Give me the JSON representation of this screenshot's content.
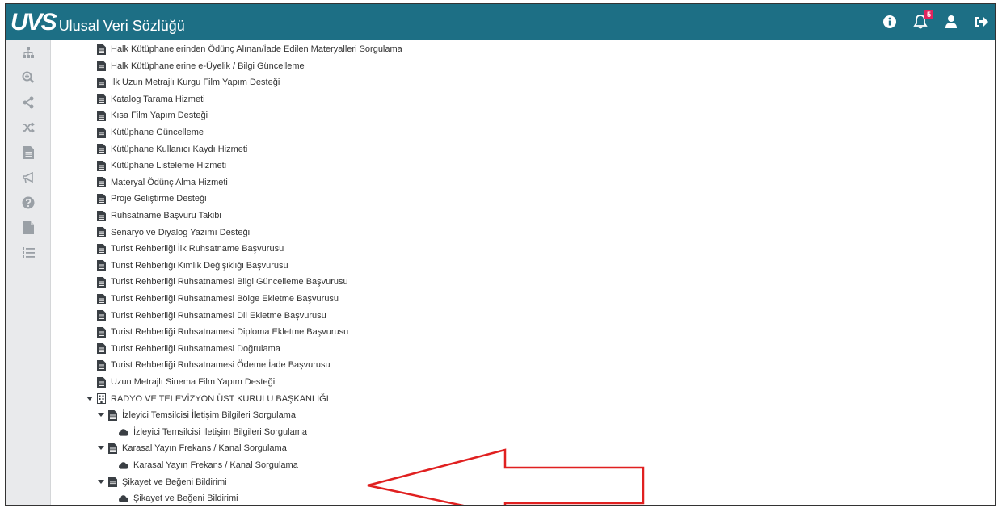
{
  "app": {
    "logo_mark": "UVS",
    "title": "Ulusal Veri Sözlüğü"
  },
  "topbar": {
    "notification_count": "5"
  },
  "sidebar": {
    "items": [
      "sitemap-icon",
      "zoom-in-icon",
      "share-icon",
      "random-icon",
      "document-icon",
      "bullhorn-icon",
      "help-icon",
      "file-icon",
      "list-ol-icon"
    ]
  },
  "list": {
    "items": [
      "Halk Kütüphanelerinden Ödünç Alınan/İade Edilen Materyalleri Sorgulama",
      "Halk Kütüphanelerine e-Üyelik / Bilgi Güncelleme",
      "İlk Uzun Metrajlı Kurgu Film Yapım Desteği",
      "Katalog Tarama Hizmeti",
      "Kısa Film Yapım Desteği",
      "Kütüphane Güncelleme",
      "Kütüphane Kullanıcı Kaydı Hizmeti",
      "Kütüphane Listeleme Hizmeti",
      "Materyal Ödünç Alma Hizmeti",
      "Proje Geliştirme Desteği",
      "Ruhsatname Başvuru Takibi",
      "Senaryo ve Diyalog Yazımı Desteği",
      "Turist Rehberliği İlk Ruhsatname Başvurusu",
      "Turist Rehberliği Kimlik Değişikliği Başvurusu",
      "Turist Rehberliği Ruhsatnamesi Bilgi Güncelleme Başvurusu",
      "Turist Rehberliği Ruhsatnamesi Bölge Ekletme Başvurusu",
      "Turist Rehberliği Ruhsatnamesi Dil Ekletme Başvurusu",
      "Turist Rehberliği Ruhsatnamesi Diploma Ekletme Başvurusu",
      "Turist Rehberliği Ruhsatnamesi Doğrulama",
      "Turist Rehberliği Ruhsatnamesi Ödeme İade Başvurusu",
      "Uzun Metrajlı Sinema Film Yapım Desteği"
    ]
  },
  "org": {
    "name": "RADYO VE TELEVİZYON ÜST KURULU BAŞKANLIĞI",
    "services": [
      {
        "label": "İzleyici Temsilcisi İletişim Bilgileri Sorgulama",
        "child": "İzleyici Temsilcisi İletişim Bilgileri Sorgulama"
      },
      {
        "label": "Karasal Yayın Frekans / Kanal Sorgulama",
        "child": "Karasal Yayın Frekans / Kanal Sorgulama"
      },
      {
        "label": "Şikayet ve Beğeni Bildirimi",
        "child": "Şikayet ve Beğeni Bildirimi"
      }
    ]
  },
  "colors": {
    "topbar": "#1d6f85",
    "sidebar": "#e9eaec",
    "icon_dark": "#3a3f44",
    "arrow": "#e02020",
    "badge": "#e0245e"
  }
}
